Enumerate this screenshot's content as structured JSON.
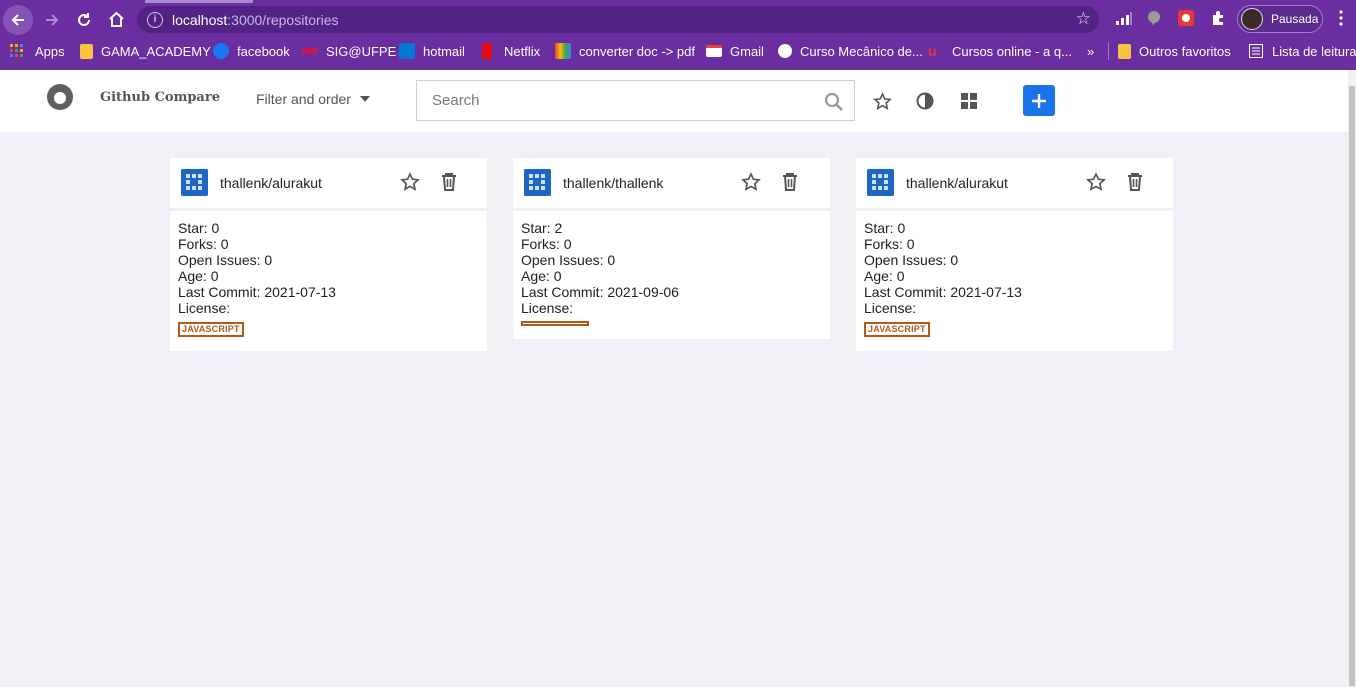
{
  "browser": {
    "url_host": "localhost",
    "url_path": ":3000/repositories",
    "profile_label": "Pausada",
    "bookmarks": [
      {
        "label": "Apps",
        "color": "#e8453c"
      },
      {
        "label": "GAMA_ACADEMY",
        "color": "#f6c343"
      },
      {
        "label": "facebook",
        "color": "#1877f2"
      },
      {
        "label": "SIG@UFPE",
        "color": "#c2185b"
      },
      {
        "label": "hotmail",
        "color": "#0078d4"
      },
      {
        "label": "Netflix",
        "color": "#e50914"
      },
      {
        "label": "converter doc -> pdf",
        "color": "#34a853"
      },
      {
        "label": "Gmail",
        "color": "#ea4335"
      },
      {
        "label": "Curso Mecânico de...",
        "color": "#ffffff"
      },
      {
        "label": "Cursos online - a q...",
        "color": "#e53935"
      },
      {
        "label": "»",
        "color": ""
      },
      {
        "label": "Outros favoritos",
        "color": "#f6c343"
      },
      {
        "label": "Lista de leitura",
        "color": "#ffffff"
      }
    ]
  },
  "header": {
    "title": "Github Compare",
    "filter_label": "Filter and order",
    "search_placeholder": "Search"
  },
  "cards": [
    {
      "name": "thallenk/alurakut",
      "star": "Star: 0",
      "forks": "Forks: 0",
      "issues": "Open Issues: 0",
      "age": "Age: 0",
      "last_commit": "Last Commit: 2021-07-13",
      "license": "License:",
      "language": "JAVASCRIPT"
    },
    {
      "name": "thallenk/thallenk",
      "star": "Star: 2",
      "forks": "Forks: 0",
      "issues": "Open Issues: 0",
      "age": "Age: 0",
      "last_commit": "Last Commit: 2021-09-06",
      "license": "License:",
      "language": ""
    },
    {
      "name": "thallenk/alurakut",
      "star": "Star: 0",
      "forks": "Forks: 0",
      "issues": "Open Issues: 0",
      "age": "Age: 0",
      "last_commit": "Last Commit: 2021-07-13",
      "license": "License:",
      "language": "JAVASCRIPT"
    }
  ],
  "colors": {
    "chrome": "#6a2ea0",
    "accent": "#1a73e8",
    "language_tag": "#b3591a"
  }
}
